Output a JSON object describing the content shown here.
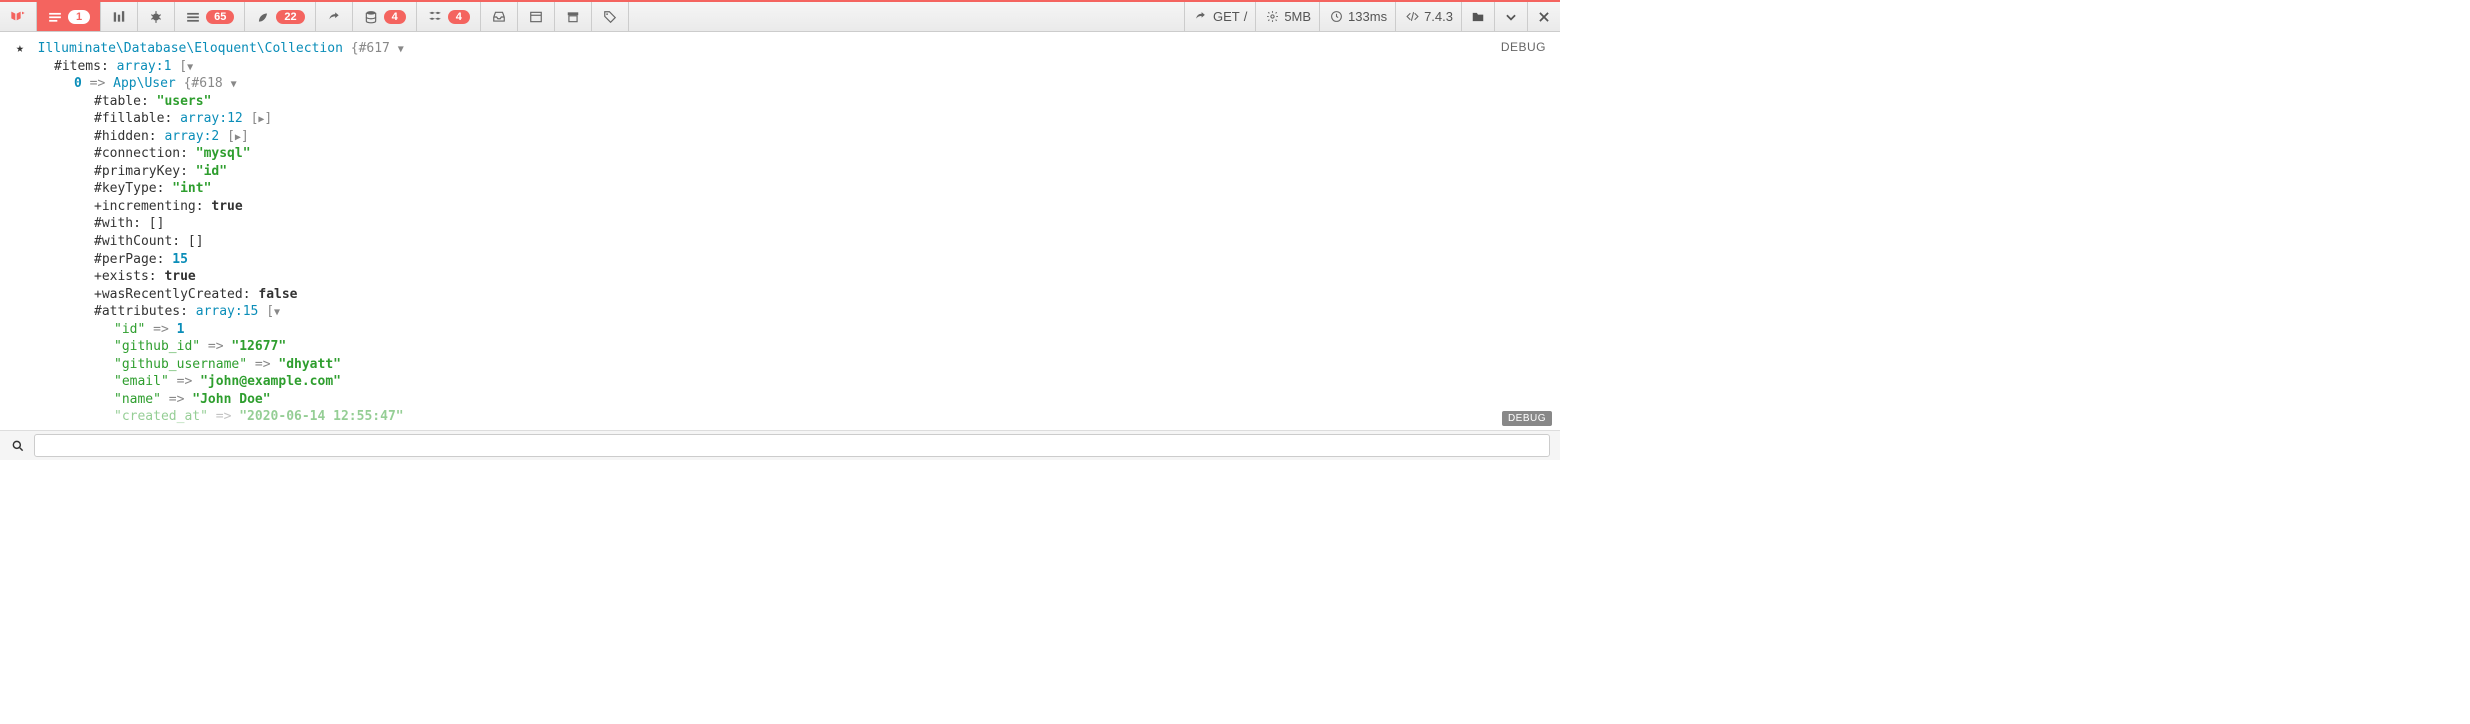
{
  "toolbar": {
    "tabs": [
      {
        "icon": "laravel",
        "badge": null
      },
      {
        "icon": "messages",
        "badge": "1",
        "active": true
      },
      {
        "icon": "timeline",
        "badge": null
      },
      {
        "icon": "exceptions",
        "badge": null
      },
      {
        "icon": "views",
        "badge": "65"
      },
      {
        "icon": "route",
        "badge": "22"
      },
      {
        "icon": "queries-arrow",
        "badge": null
      },
      {
        "icon": "database",
        "badge": "4"
      },
      {
        "icon": "models",
        "badge": "4"
      },
      {
        "icon": "mail",
        "badge": null
      },
      {
        "icon": "gate",
        "badge": null
      },
      {
        "icon": "session",
        "badge": null
      },
      {
        "icon": "request",
        "badge": null
      }
    ],
    "right": {
      "method": "GET",
      "path": "/",
      "memory": "5MB",
      "time": "133ms",
      "php": "7.4.3"
    }
  },
  "dump": {
    "class": "Illuminate\\Database\\Eloquent\\Collection",
    "id": "#617",
    "items_label": "#items:",
    "items_type": "array:1",
    "index": "0",
    "user_class": "App\\User",
    "user_id": "#618",
    "props": {
      "table": {
        "k": "#table:",
        "v": "\"users\""
      },
      "fillable": {
        "k": "#fillable:",
        "v": "array:12"
      },
      "hidden": {
        "k": "#hidden:",
        "v": "array:2"
      },
      "connection": {
        "k": "#connection:",
        "v": "\"mysql\""
      },
      "primaryKey": {
        "k": "#primaryKey:",
        "v": "\"id\""
      },
      "keyType": {
        "k": "#keyType:",
        "v": "\"int\""
      },
      "incrementing": {
        "k": "+incrementing:",
        "v": "true"
      },
      "with": {
        "k": "#with:",
        "v": "[]"
      },
      "withCount": {
        "k": "#withCount:",
        "v": "[]"
      },
      "perPage": {
        "k": "#perPage:",
        "v": "15"
      },
      "exists": {
        "k": "+exists:",
        "v": "true"
      },
      "wasRecentlyCreated": {
        "k": "+wasRecentlyCreated:",
        "v": "false"
      },
      "attributes": {
        "k": "#attributes:",
        "v": "array:15"
      }
    },
    "attrs": {
      "id": {
        "k": "\"id\"",
        "v": "1"
      },
      "github_id": {
        "k": "\"github_id\"",
        "v": "\"12677\""
      },
      "github_username": {
        "k": "\"github_username\"",
        "v": "\"dhyatt\""
      },
      "email": {
        "k": "\"email\"",
        "v": "\"john@example.com\""
      },
      "name": {
        "k": "\"name\"",
        "v": "\"John Doe\""
      },
      "created_at": {
        "k": "\"created_at\"",
        "v": "\"2020-06-14 12:55:47\""
      }
    }
  },
  "labels": {
    "debug": "DEBUG",
    "debug_badge": "DEBUG"
  },
  "search": {
    "placeholder": ""
  }
}
